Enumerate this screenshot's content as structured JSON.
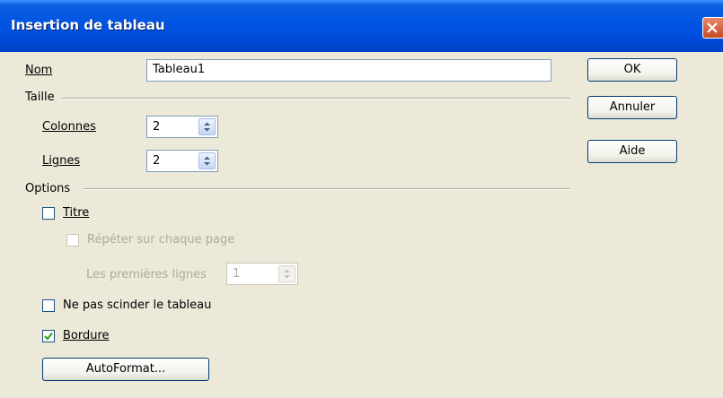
{
  "window": {
    "title": "Insertion de tableau"
  },
  "name": {
    "label": "Nom",
    "value": "Tableau1"
  },
  "size": {
    "section": "Taille",
    "columns_label": "Colonnes",
    "columns_value": "2",
    "rows_label": "Lignes",
    "rows_value": "2"
  },
  "options": {
    "section": "Options",
    "title_label": "Titre",
    "title_checked": false,
    "repeat_label": "Répéter sur chaque page",
    "repeat_checked": false,
    "first_rows_label": "Les premières lignes",
    "first_rows_value": "1",
    "nosplit_label": "Ne pas scinder le tableau",
    "nosplit_checked": false,
    "border_label": "Bordure",
    "border_checked": true,
    "autoformat_label": "AutoFormat..."
  },
  "buttons": {
    "ok": "OK",
    "cancel": "Annuler",
    "help": "Aide"
  }
}
